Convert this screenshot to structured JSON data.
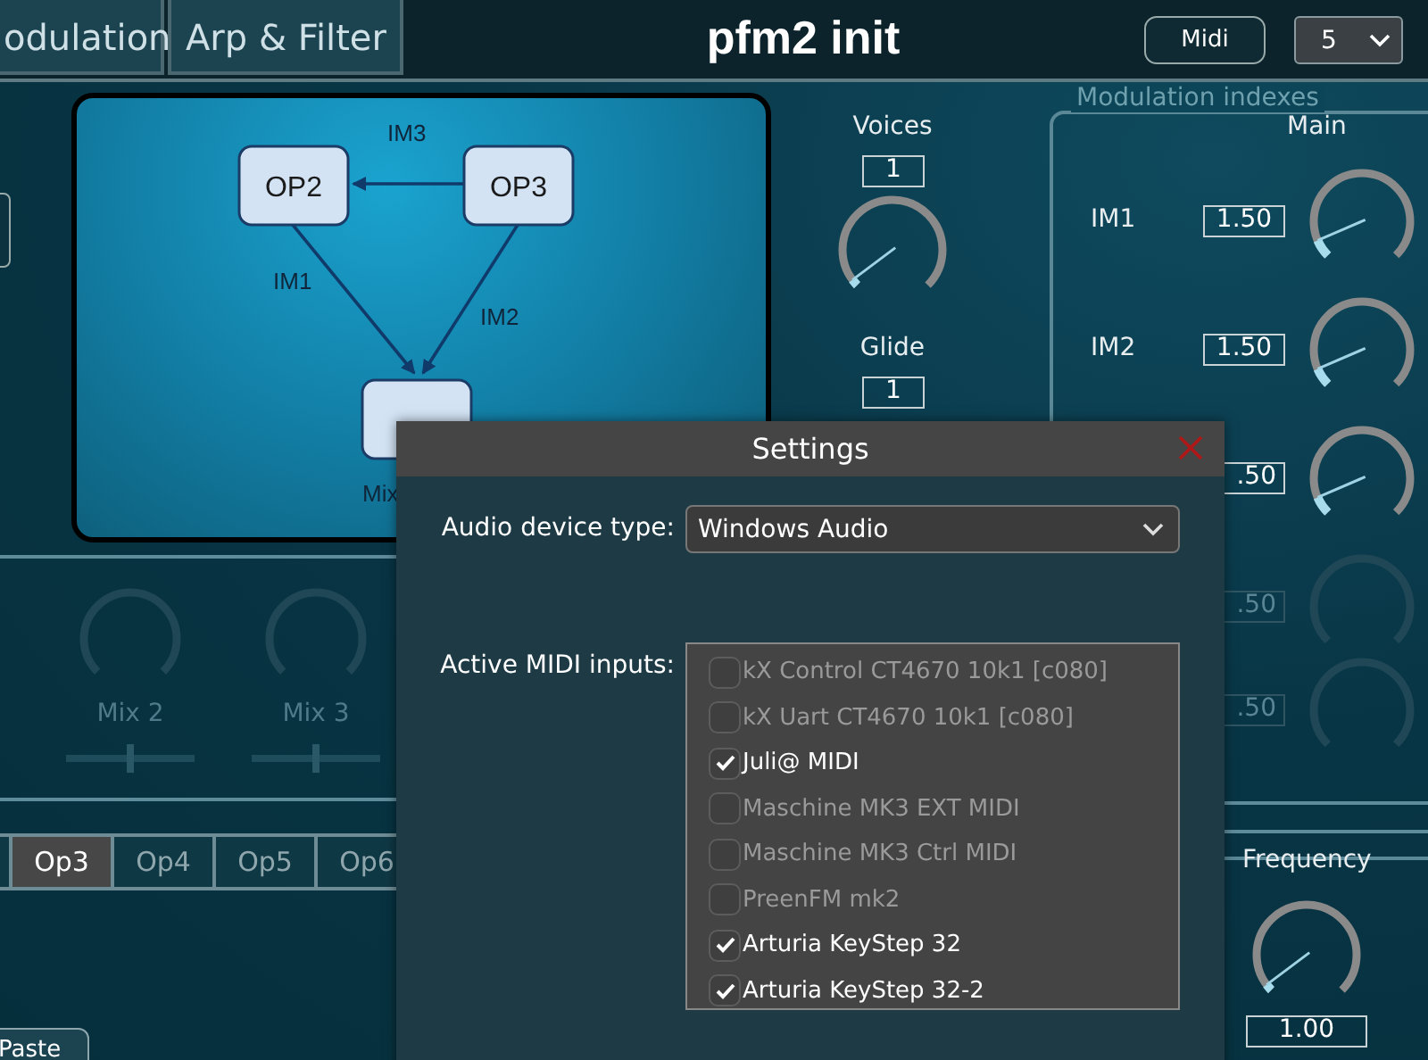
{
  "header": {
    "tabs": [
      {
        "label": "odulation",
        "selected": false
      },
      {
        "label": "Arp & Filter",
        "selected": false
      }
    ],
    "title": "pfm2 init",
    "midi_button": "Midi",
    "preset_select": "5"
  },
  "algorithm": {
    "operators": [
      {
        "label": "OP2"
      },
      {
        "label": "OP3"
      }
    ],
    "links": [
      "IM3",
      "IM1",
      "IM2"
    ],
    "output": "Mix"
  },
  "voices": {
    "label": "Voices",
    "value": "1",
    "level": 0.03
  },
  "glide": {
    "label": "Glide",
    "value": "1"
  },
  "modulation_indexes": {
    "title": "Modulation indexes",
    "column": "Main",
    "rows": [
      {
        "label": "IM1",
        "value": "1.50",
        "level": 0.08,
        "disabled": false
      },
      {
        "label": "IM2",
        "value": "1.50",
        "level": 0.08,
        "disabled": false
      },
      {
        "value": ".50",
        "level": 0.08,
        "disabled": false
      },
      {
        "value": ".50",
        "disabled": true
      },
      {
        "value": ".50",
        "disabled": true
      }
    ]
  },
  "mixers": [
    {
      "label": "Mix 2",
      "level": 0.5,
      "disabled": true
    },
    {
      "label": "Mix 3",
      "level": 0.5,
      "disabled": true
    }
  ],
  "operator_tabs": [
    {
      "label": "Op3",
      "selected": true
    },
    {
      "label": "Op4",
      "selected": false
    },
    {
      "label": "Op5",
      "selected": false
    },
    {
      "label": "Op6",
      "selected": false
    }
  ],
  "paste_button": "Paste",
  "frequency": {
    "label": "Frequency",
    "value": "1.00",
    "level": 0.03
  },
  "settings_dialog": {
    "title": "Settings",
    "audio_device_label": "Audio device type:",
    "audio_device": "Windows Audio",
    "midi_label": "Active MIDI inputs:",
    "midi_inputs": [
      {
        "label": "kX Control CT4670 10k1 [c080]",
        "checked": false
      },
      {
        "label": "kX Uart CT4670 10k1 [c080]",
        "checked": false
      },
      {
        "label": "Juli@ MIDI",
        "checked": true
      },
      {
        "label": "Maschine MK3 EXT MIDI",
        "checked": false
      },
      {
        "label": "Maschine MK3 Ctrl MIDI",
        "checked": false
      },
      {
        "label": "PreenFM mk2",
        "checked": false
      },
      {
        "label": "Arturia KeyStep 32",
        "checked": true
      },
      {
        "label": "Arturia KeyStep 32-2",
        "checked": true
      }
    ]
  }
}
